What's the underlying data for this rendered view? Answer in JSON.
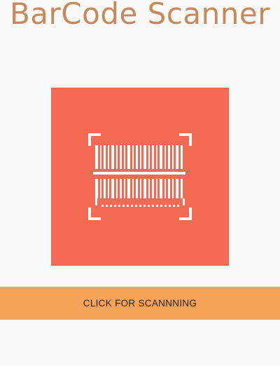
{
  "header": {
    "title": "BarCode Scanner"
  },
  "scan_graphic": {
    "icon": "barcode-scan-icon",
    "background_color": "#f26b52",
    "icon_color": "#ffffff"
  },
  "scan_button": {
    "label": "CLICK FOR SCANNNING",
    "background_color": "#f7a35a"
  },
  "colors": {
    "title": "#c8895a",
    "page_background": "#fafafa"
  }
}
